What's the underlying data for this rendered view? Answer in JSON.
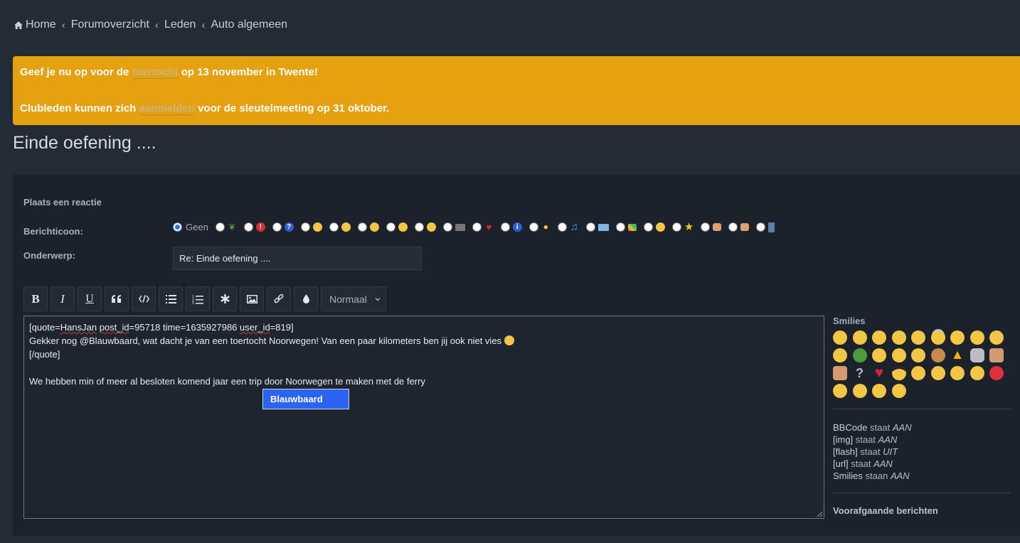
{
  "breadcrumb": {
    "items": [
      "Home",
      "Forumoverzicht",
      "Leden",
      "Auto algemeen"
    ],
    "separator": "‹"
  },
  "notice": {
    "line1_pre": "Geef je nu op voor de",
    "line1_link": "toertocht",
    "line1_post": "op 13 november in Twente!",
    "line2_pre": "Clubleden kunnen zich",
    "line2_link": "aanmelden",
    "line2_post": "voor de sleutelmeeting op 31 oktober.",
    "bg_color": "#e5a10f"
  },
  "page_title": "Einde oefening ....",
  "form": {
    "title": "Plaats een reactie",
    "icon_label": "Berichticoon:",
    "none_option": "Geen",
    "icon_options": [
      "pickle-icon",
      "exclamation-icon",
      "question-icon",
      "happy-face-icon",
      "neutral-face-icon",
      "wink-face-icon",
      "grin-face-icon",
      "tongue-face-icon",
      "clapper-icon",
      "heart-icon",
      "info-icon",
      "lightbulb-icon",
      "music-note-icon",
      "id-card-icon",
      "rainbow-icon",
      "surprised-face-icon",
      "star-icon",
      "thumbs-down-icon",
      "thumbs-up-icon",
      "film-icon"
    ],
    "subject_label": "Onderwerp:",
    "subject_value": "Re: Einde oefening ...."
  },
  "toolbar": {
    "bold": "B",
    "italic": "I",
    "underline": "U",
    "size_select": "Normaal"
  },
  "editor": {
    "quote_open_a": "[quote=",
    "quote_user": "HansJan",
    "quote_sp": " ",
    "quote_postid": "post_id",
    "quote_mid": "=95718 time=1635927986 ",
    "quote_userid": "user_id",
    "quote_end": "=819]",
    "line2": "Gekker nog @Blauwbaard, wat dacht je van een toertocht Noorwegen! Van een paar kilometers ben jij ook niet vies",
    "line3": "[/quote]",
    "line5": "We hebben min of meer al besloten komend jaar een trip door Noorwegen te maken met de ferry",
    "mention": "Blauwbaard"
  },
  "side": {
    "smilies_title": "Smilies",
    "smilies": [
      "smile",
      "kiss",
      "expressionless",
      "flushed",
      "joy",
      "innocent",
      "confounded",
      "sleeping",
      "wink",
      "tongue-wink",
      "frog",
      "unamused",
      "neutral",
      "grinning",
      "cookie",
      "warning",
      "rolling-eyes-alt",
      "thumbs-down",
      "thumbs-up",
      "question",
      "heart",
      "sunglasses",
      "tongue",
      "rolling-eyes",
      "frowning",
      "angry",
      "rage",
      "blush",
      "confused",
      "sleepy",
      "sob"
    ],
    "bb": [
      {
        "k": "BBCode",
        "mid": " staat ",
        "v": "AAN"
      },
      {
        "k": "[img]",
        "mid": " staat ",
        "v": "AAN"
      },
      {
        "k": "[flash]",
        "mid": " staat ",
        "v": "UIT"
      },
      {
        "k": "[url]",
        "mid": " staat ",
        "v": "AAN"
      },
      {
        "k": "Smilies",
        "mid": " staan ",
        "v": "AAN"
      }
    ],
    "previous_title": "Voorafgaande berichten"
  }
}
